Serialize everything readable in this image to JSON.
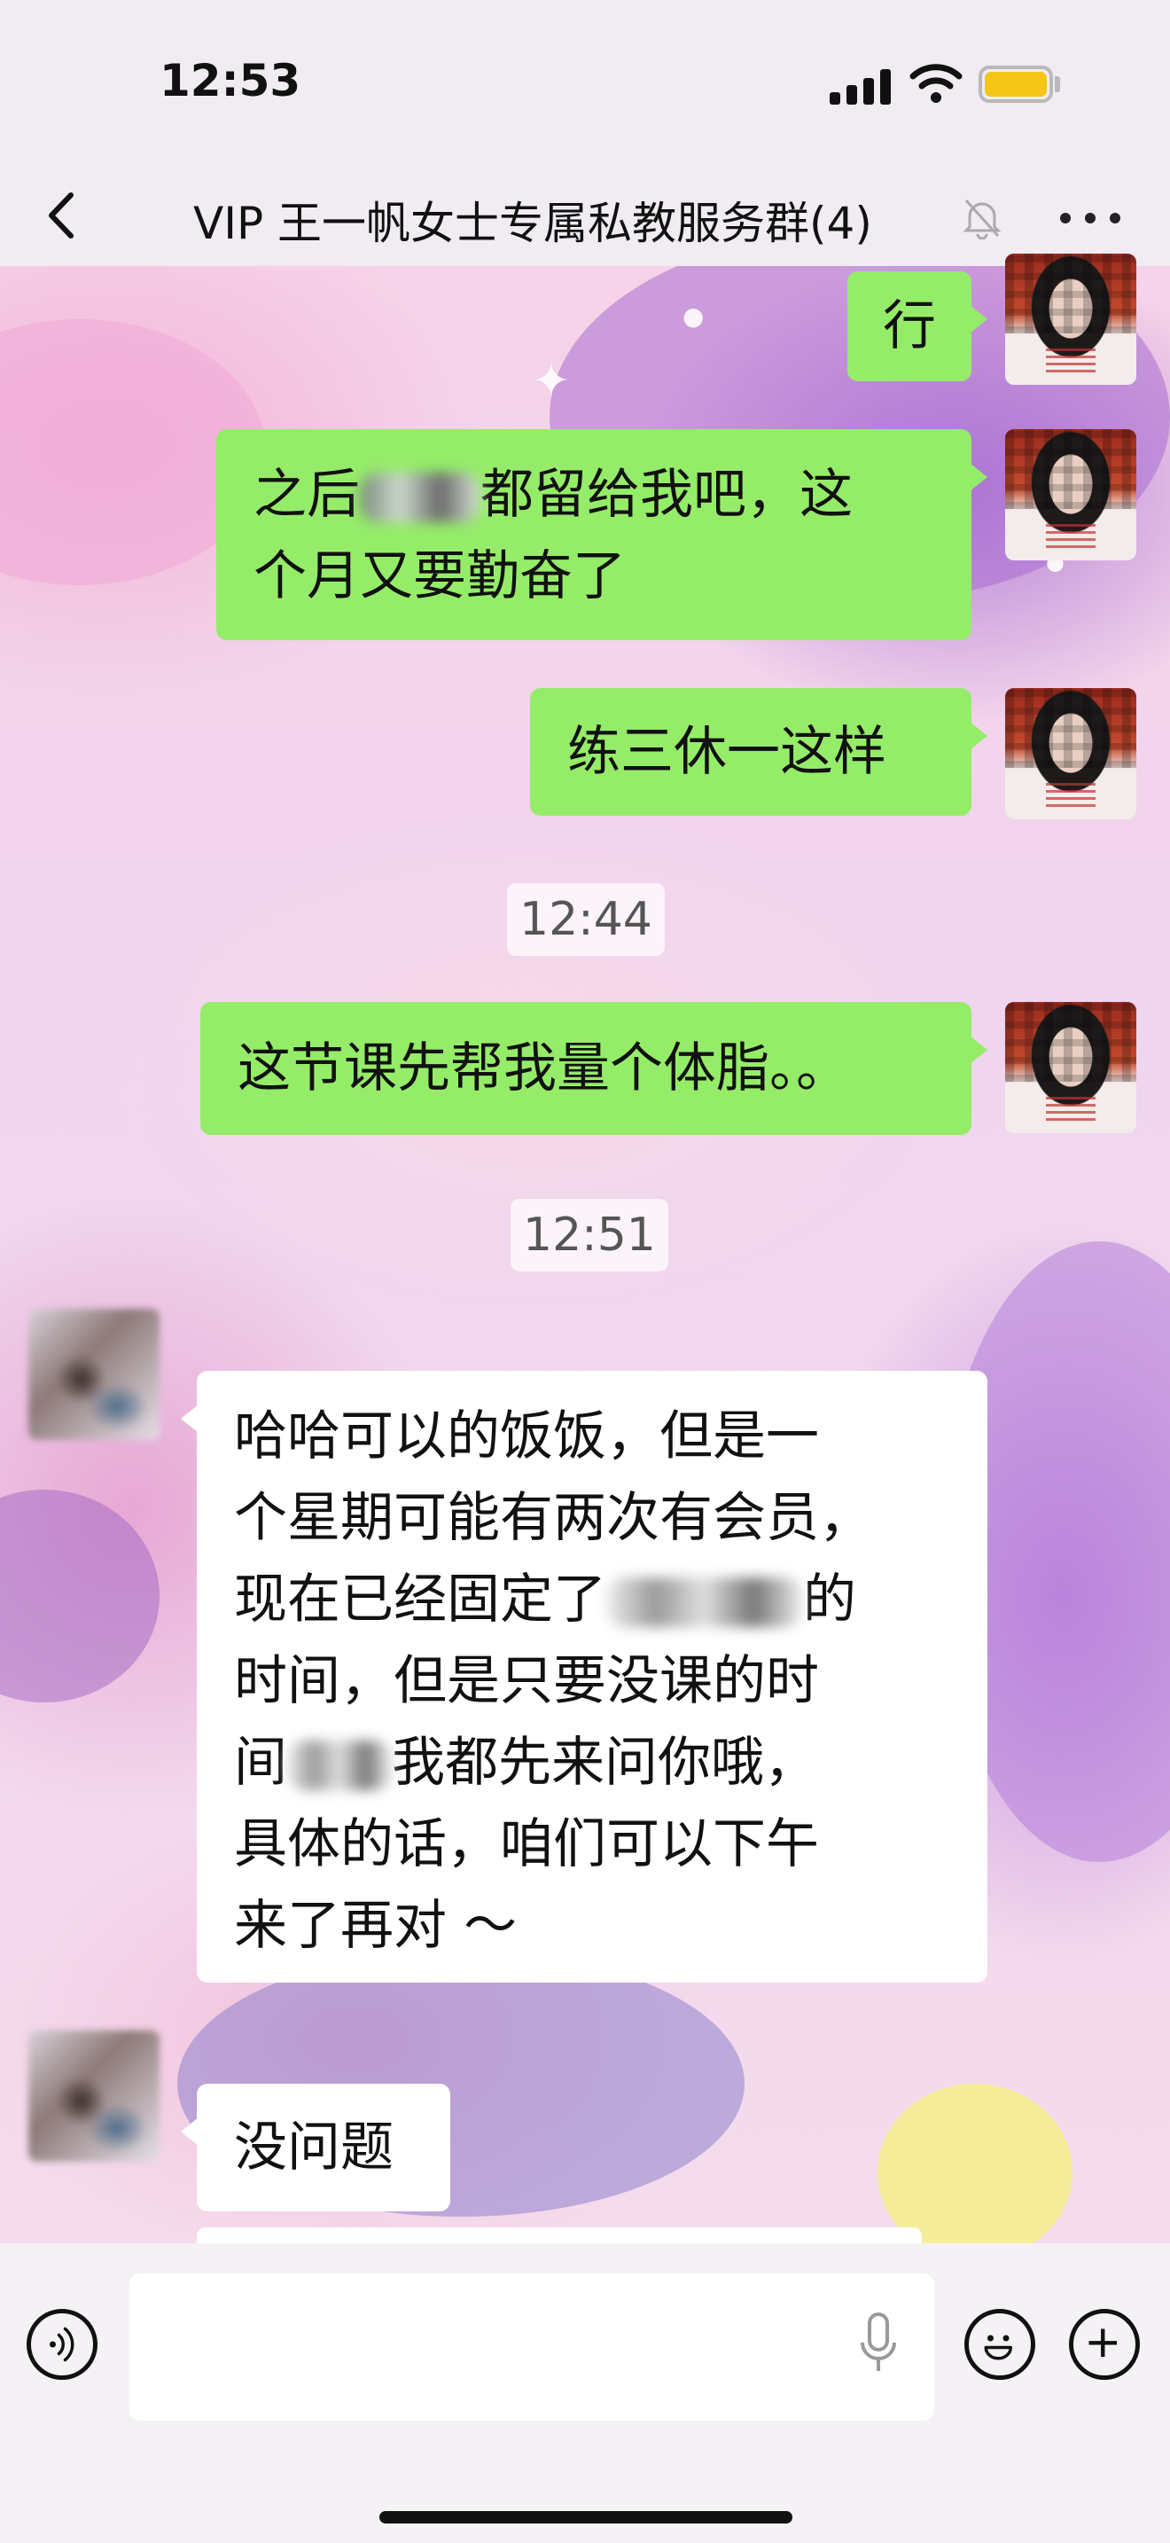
{
  "status_bar": {
    "time": "12:53"
  },
  "nav": {
    "title": "VIP 王一帆女士专属私教服务群(4)"
  },
  "messages": {
    "m1": {
      "text": "行"
    },
    "m2": {
      "line1_pre": "之后",
      "line1_post": "都留给我吧，这",
      "line2": "个月又要勤奋了"
    },
    "m3": {
      "text": "练三休一这样"
    },
    "ts1": "12:44",
    "m4": {
      "text": "这节课先帮我量个体脂。。"
    },
    "ts2": "12:51",
    "m5": {
      "line1": "哈哈可以的饭饭，但是一",
      "line2": "个星期可能有两次有会员，",
      "line3_pre": "现在已经固定了",
      "line3_post": "的",
      "line4": "时间，但是只要没课的时",
      "line5_pre": "间",
      "line5_post": "我都先来问你哦，",
      "line6": "具体的话，咱们可以下午",
      "line7": "来了再对 ～"
    },
    "m6": {
      "text": "没问题"
    }
  },
  "colors": {
    "self_bubble": "#95ec69",
    "other_bubble": "#ffffff",
    "battery": "#f5c518"
  },
  "icons": [
    "back-icon",
    "mute-bell-icon",
    "more-icon",
    "voice-icon",
    "mic-icon",
    "emoji-icon",
    "plus-icon"
  ]
}
